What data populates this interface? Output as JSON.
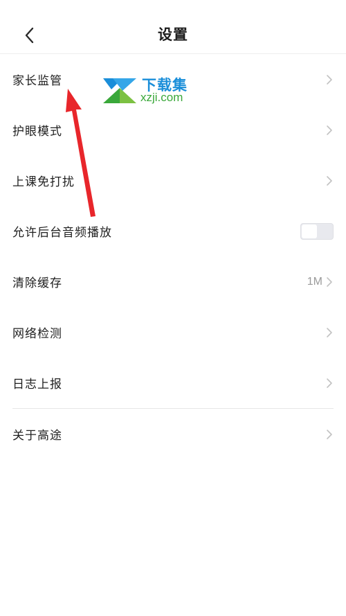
{
  "header": {
    "title": "设置",
    "back_icon": "chevron-left-icon"
  },
  "settings": {
    "items": [
      {
        "label": "家长监管"
      },
      {
        "label": "护眼模式"
      },
      {
        "label": "上课免打扰"
      },
      {
        "label": "允许后台音频播放",
        "toggle_on": false
      },
      {
        "label": "清除缓存",
        "value": "1M"
      },
      {
        "label": "网络检测"
      },
      {
        "label": "日志上报"
      },
      {
        "label": "关于高途"
      }
    ]
  },
  "watermark": {
    "text_cn": "下载集",
    "text_en": "xzji.com"
  },
  "colors": {
    "annotation_arrow": "#e8262b",
    "chevron": "#c2c2c2",
    "watermark_blue": "#1a8ed9",
    "watermark_green": "#3aa83a"
  }
}
